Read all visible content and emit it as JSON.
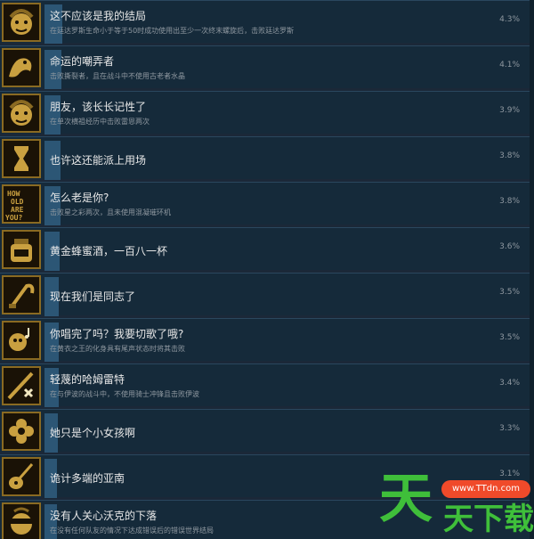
{
  "achievements": [
    {
      "title": "这不应该是我的结局",
      "desc": "在廷达罗斯生命小于等于50时成功使用出至少一次终末螺旋后，击败廷达罗斯",
      "pct": "4.3%",
      "pct_value": 4.3,
      "icon": "character-portrait-icon"
    },
    {
      "title": "命运的嘲弄者",
      "desc": "击败撕裂者，且在战斗中不使用古老者水晶",
      "pct": "4.1%",
      "pct_value": 4.1,
      "icon": "creature-icon"
    },
    {
      "title": "朋友，该长长记性了",
      "desc": "在单次横祖经历中击败雷恩两次",
      "pct": "3.9%",
      "pct_value": 3.9,
      "icon": "character-portrait-icon"
    },
    {
      "title": "也许这还能派上用场",
      "desc": "",
      "pct": "3.8%",
      "pct_value": 3.8,
      "icon": "hourglass-icon"
    },
    {
      "title": "怎么老是你?",
      "desc": "击败星之彩两次，且未使用混凝璀环机",
      "pct": "3.8%",
      "pct_value": 3.8,
      "icon": "how-old-are-you-text-icon",
      "icon_text": [
        "HOW",
        "OLD",
        "ARE",
        "YOU?"
      ]
    },
    {
      "title": "黄金蜂蜜酒，一百八一杯",
      "desc": "",
      "pct": "3.6%",
      "pct_value": 3.6,
      "icon": "honey-jar-icon"
    },
    {
      "title": "现在我们是同志了",
      "desc": "",
      "pct": "3.5%",
      "pct_value": 3.5,
      "icon": "sickle-icon"
    },
    {
      "title": "你唱完了吗？我要切歌了哦?",
      "desc": "在黄衣之王的化身具有尾声状态时将其击败",
      "pct": "3.5%",
      "pct_value": 3.5,
      "icon": "singer-portrait-icon"
    },
    {
      "title": "轻蔑的哈姆雷特",
      "desc": "在与伊波的战斗中，不使用骑士冲锋且击败伊波",
      "pct": "3.4%",
      "pct_value": 3.4,
      "icon": "sword-cross-icon"
    },
    {
      "title": "她只是个小女孩啊",
      "desc": "",
      "pct": "3.3%",
      "pct_value": 3.3,
      "icon": "flower-icon"
    },
    {
      "title": "诡计多端的亚南",
      "desc": "",
      "pct": "3.1%",
      "pct_value": 3.1,
      "icon": "guitar-icon"
    },
    {
      "title": "没有人关心沃克的下落",
      "desc": "在没有任何队友的情况下达成错误后的错误世界结局",
      "pct": "",
      "pct_value": null,
      "icon": "blindfold-portrait-icon"
    }
  ],
  "watermark": {
    "site": "www.TTdn.com",
    "big": "天",
    "small": "天下载"
  },
  "colors": {
    "background": "#1b2838",
    "row": "#152a3a",
    "bar": "#2c5675",
    "icon_gold": "#c9a040"
  }
}
